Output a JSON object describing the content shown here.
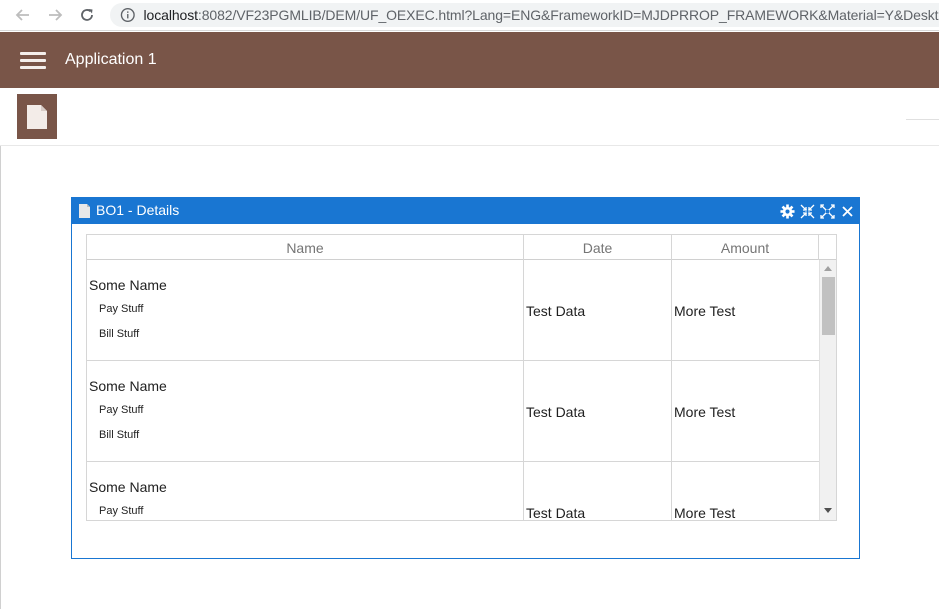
{
  "browser": {
    "url_host": "localhost",
    "url_rest": ":8082/VF23PGMLIB/DEM/UF_OEXEC.html?Lang=ENG&FrameworkID=MJDPRROP_FRAMEWORK&Material=Y&Desktop="
  },
  "app": {
    "title": "Application 1",
    "accent": "#795548"
  },
  "window": {
    "title": "BO1 - Details",
    "accent": "#1976d2"
  },
  "grid": {
    "columns": [
      "Name",
      "Date",
      "Amount"
    ],
    "rows": [
      {
        "name": "Some Name",
        "sub1": "Pay Stuff",
        "sub2": "Bill Stuff",
        "date": "Test Data",
        "amount": "More Test"
      },
      {
        "name": "Some Name",
        "sub1": "Pay Stuff",
        "sub2": "Bill Stuff",
        "date": "Test Data",
        "amount": "More Test"
      },
      {
        "name": "Some Name",
        "sub1": "Pay Stuff",
        "sub2": "",
        "date": "Test Data",
        "amount": "More Test"
      }
    ]
  },
  "icons": {
    "back": "arrow-left-icon",
    "forward": "arrow-right-icon",
    "reload": "reload-icon",
    "info": "info-icon",
    "menu": "hamburger-icon",
    "document": "document-icon",
    "settings": "gear-icon",
    "restore": "restore-icon",
    "maximize": "maximize-icon",
    "close": "close-icon"
  }
}
